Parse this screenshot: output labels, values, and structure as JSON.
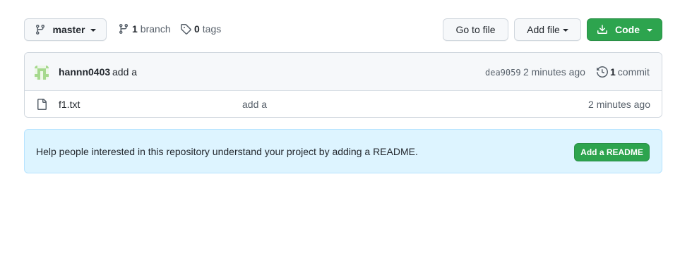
{
  "toolbar": {
    "branch_name": "master",
    "branch_count": "1",
    "branch_label": "branch",
    "tag_count": "0",
    "tag_label": "tags",
    "go_to_file": "Go to file",
    "add_file": "Add file",
    "code": "Code"
  },
  "commit": {
    "author": "hannn0403",
    "message": "add a",
    "sha": "dea9059",
    "time": "2 minutes ago",
    "count": "1",
    "count_label": "commit"
  },
  "files": [
    {
      "name": "f1.txt",
      "message": "add a",
      "time": "2 minutes ago",
      "icon": "file-icon"
    }
  ],
  "readme": {
    "text": "Help people interested in this repository understand your project by adding a README.",
    "button": "Add a README"
  },
  "colors": {
    "primary_green": "#2da44e",
    "readme_bg": "#ddf4ff",
    "header_bg": "#f6f8fa"
  }
}
